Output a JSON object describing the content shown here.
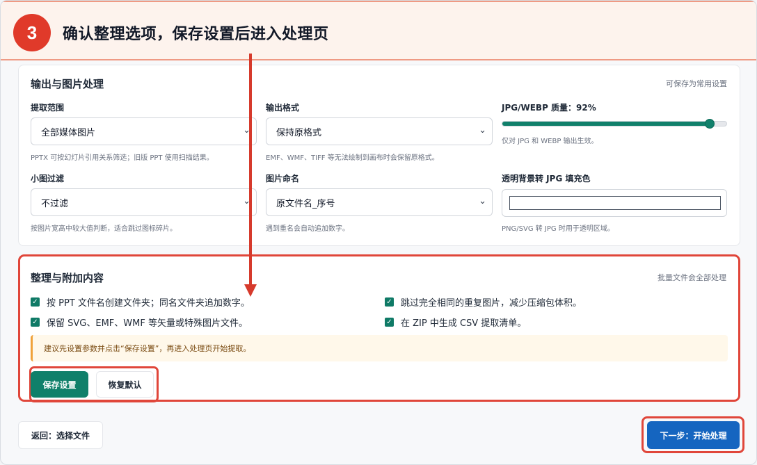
{
  "banner": {
    "step_number": "3",
    "title": "确认整理选项，保存设置后进入处理页"
  },
  "output_card": {
    "title": "输出与图片处理",
    "aside": "可保存为常用设置",
    "extract_range": {
      "label": "提取范围",
      "value": "全部媒体图片",
      "hint": "PPTX 可按幻灯片引用关系筛选；旧版 PPT 使用扫描结果。"
    },
    "output_format": {
      "label": "输出格式",
      "value": "保持原格式",
      "hint": "EMF、WMF、TIFF 等无法绘制到画布时会保留原格式。"
    },
    "quality": {
      "label": "JPG/WEBP 质量：92%",
      "value": 92,
      "hint": "仅对 JPG 和 WEBP 输出生效。"
    },
    "small_filter": {
      "label": "小图过滤",
      "value": "不过滤",
      "hint": "按图片宽高中较大值判断，适合跳过图标碎片。"
    },
    "naming": {
      "label": "图片命名",
      "value": "原文件名_序号",
      "hint": "遇到重名会自动追加数字。"
    },
    "fill_color": {
      "label": "透明背景转 JPG 填充色",
      "value": "#ffffff",
      "hint": "PNG/SVG 转 JPG 时用于透明区域。"
    }
  },
  "organize_card": {
    "title": "整理与附加内容",
    "aside": "批量文件会全部处理",
    "options": [
      {
        "label": "按 PPT 文件名创建文件夹；同名文件夹追加数字。",
        "checked": true
      },
      {
        "label": "跳过完全相同的重复图片，减少压缩包体积。",
        "checked": true
      },
      {
        "label": "保留 SVG、EMF、WMF 等矢量或特殊图片文件。",
        "checked": true
      },
      {
        "label": "在 ZIP 中生成 CSV 提取清单。",
        "checked": true
      }
    ],
    "notice": "建议先设置参数并点击“保存设置”，再进入处理页开始提取。",
    "save_label": "保存设置",
    "reset_label": "恢复默认"
  },
  "footer": {
    "back_label": "返回：选择文件",
    "next_label": "下一步：开始处理"
  },
  "colors": {
    "accent_green": "#10806a",
    "primary_blue": "#1565c0",
    "highlight_red": "#e0463a"
  },
  "icons": {
    "check": "checkmark-icon",
    "chevron": "chevron-down-icon",
    "arrow": "down-arrow-icon"
  }
}
